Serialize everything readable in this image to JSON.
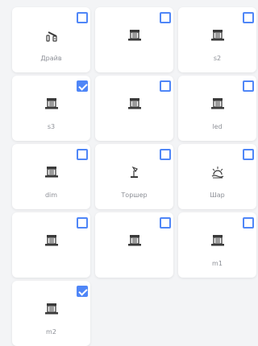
{
  "devices": [
    {
      "label": "Драйв",
      "icon": "garage-drive-icon",
      "checked": false
    },
    {
      "label": "",
      "icon": "building-icon",
      "checked": false
    },
    {
      "label": "s2",
      "icon": "building-icon",
      "checked": false
    },
    {
      "label": "s3",
      "icon": "building-icon",
      "checked": true
    },
    {
      "label": "",
      "icon": "building-icon",
      "checked": false
    },
    {
      "label": "led",
      "icon": "building-icon",
      "checked": false
    },
    {
      "label": "dim",
      "icon": "building-icon",
      "checked": false
    },
    {
      "label": "Торшер",
      "icon": "floor-lamp-icon",
      "checked": false
    },
    {
      "label": "Шар",
      "icon": "ball-light-icon",
      "checked": false
    },
    {
      "label": "",
      "icon": "building-icon",
      "checked": false
    },
    {
      "label": "",
      "icon": "building-icon",
      "checked": false
    },
    {
      "label": "m1",
      "icon": "building-icon",
      "checked": false
    },
    {
      "label": "m2",
      "icon": "building-icon",
      "checked": true
    }
  ],
  "colors": {
    "accent": "#4f86f7",
    "icon": "#3a3a3a",
    "label": "#8c8f96"
  }
}
